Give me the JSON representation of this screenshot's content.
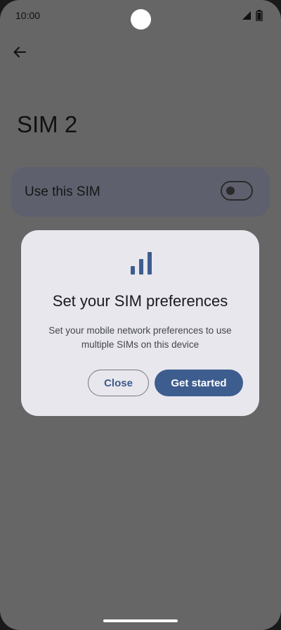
{
  "status_bar": {
    "time": "10:00",
    "icons": [
      "signal-icon",
      "battery-icon"
    ]
  },
  "header": {
    "back_icon": "arrow-left-icon",
    "title": "SIM 2"
  },
  "setting": {
    "label": "Use this SIM",
    "toggle_state": "off"
  },
  "dialog": {
    "icon": "signal-bars-icon",
    "title": "Set your SIM preferences",
    "body": "Set your mobile network preferences to use multiple SIMs on this device",
    "close_label": "Close",
    "start_label": "Get started"
  },
  "colors": {
    "scrim_background": "#666666",
    "dialog_background": "#e8e7ed",
    "primary": "#3e5d8f",
    "setting_card": "#5e616d"
  }
}
